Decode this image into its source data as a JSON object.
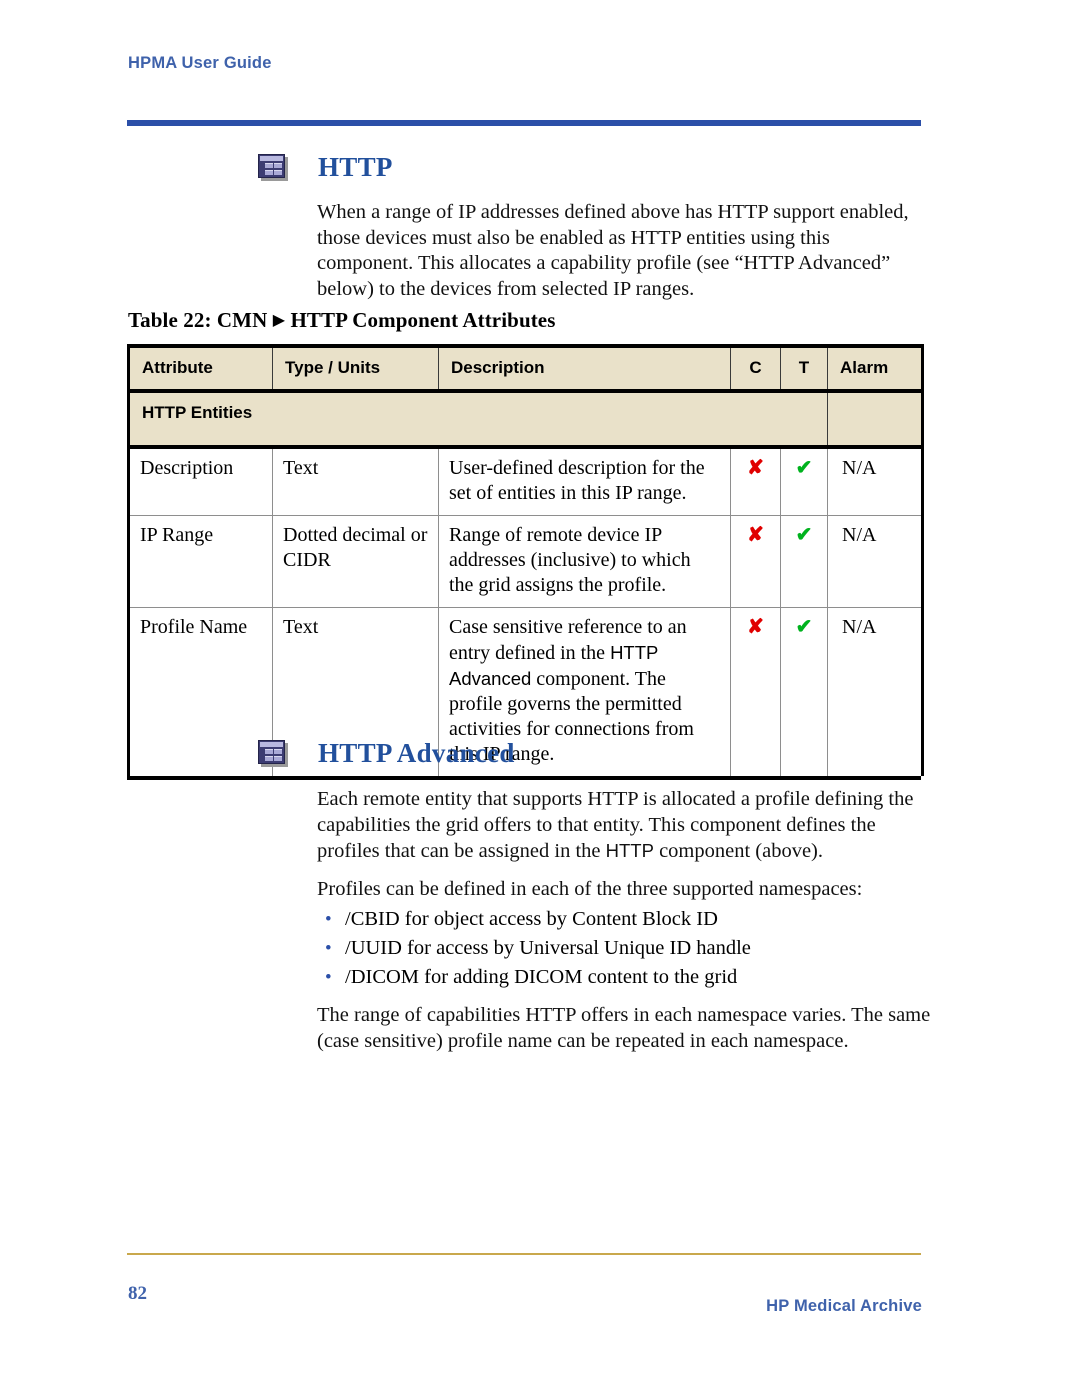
{
  "header": {
    "running_title": "HPMA User Guide",
    "rule_color": "#2b4fa8"
  },
  "sections": [
    {
      "id": "http",
      "icon": "component-window-icon",
      "title": "HTTP",
      "title_color": "#22509c",
      "paragraphs": [
        "When a range of IP addresses defined above has HTTP support enabled, those devices must also be enabled as HTTP entities using this component. This allocates a capability profile (see “HTTP Advanced” below) to the devices from selected IP ranges."
      ]
    },
    {
      "id": "http-advanced",
      "icon": "component-window-icon",
      "title": "HTTP Advanced",
      "title_color": "#22509c",
      "paragraphs": [
        {
          "pre": "Each remote entity that supports HTTP is allocated a profile defining the capabilities the grid offers to that entity. This component defines the profiles that can be assigned in the ",
          "ui_ref": "HTTP",
          "post": " component (above)."
        },
        "Profiles can be defined in each of the three supported namespaces:"
      ],
      "bullets": [
        "/CBID for object access by Content Block ID",
        "/UUID for access by Universal Unique ID handle",
        "/DICOM for adding DICOM content to the grid"
      ],
      "closing_paragraph": "The range of capabilities HTTP offers in each namespace varies. The same (case sensitive) profile name can be repeated in each namespace."
    }
  ],
  "table": {
    "caption_prefix": "Table 22: CMN",
    "caption_arrow": "▶",
    "caption_suffix": "HTTP Component Attributes",
    "header_background": "#e9e1c9",
    "columns": [
      "Attribute",
      "Type / Units",
      "Description",
      "C",
      "T",
      "Alarm"
    ],
    "group_row": "HTTP Entities",
    "rows": [
      {
        "attribute": "Description",
        "type_units": "Text",
        "description": "User-defined description for the set of entities in this IP range.",
        "c": "✘",
        "t": "✔",
        "alarm": "N/A"
      },
      {
        "attribute": "IP Range",
        "type_units": "Dotted decimal or CIDR",
        "description": "Range of remote device IP addresses (inclusive) to which the grid assigns the profile.",
        "c": "✘",
        "t": "✔",
        "alarm": "N/A"
      },
      {
        "attribute": "Profile Name",
        "type_units": "Text",
        "description_pre": "Case sensitive reference to an entry defined in the ",
        "description_ui_ref": "HTTP Advanced",
        "description_post": " component. The profile governs the permitted activities for connections from this IP range.",
        "c": "✘",
        "t": "✔",
        "alarm": "N/A"
      }
    ],
    "mark_colors": {
      "cross": "#e00000",
      "check": "#00b21e"
    }
  },
  "footer": {
    "page_number": "82",
    "product_name": "HP Medical Archive",
    "rule_color": "#c9a84c",
    "text_color": "#3f62ab"
  }
}
